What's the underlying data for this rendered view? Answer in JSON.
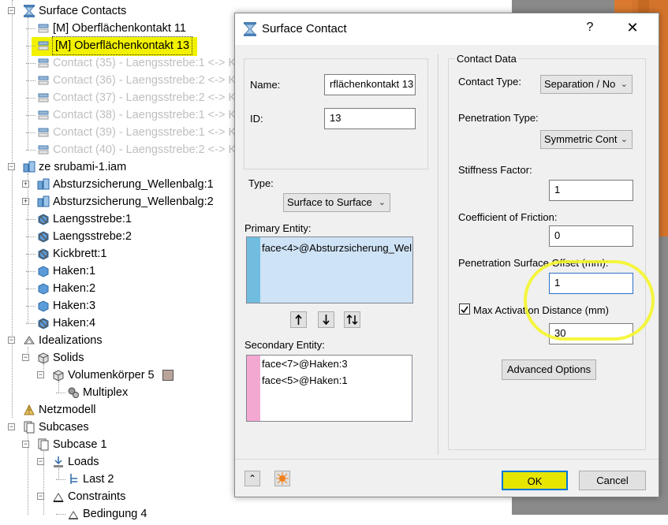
{
  "tree": {
    "rows": [
      {
        "label": "Surface Contacts",
        "icon": "hourglass-icon",
        "dim": false
      },
      {
        "label": "[M] Oberflächenkontakt 11",
        "icon": "contact-icon",
        "dim": false
      },
      {
        "label": "[M] Oberflächenkontakt 13",
        "icon": "contact-icon",
        "dim": false,
        "selected": true
      },
      {
        "label": "Contact (35) - Laengsstrebe:1 <-> K",
        "icon": "contact-icon",
        "dim": true
      },
      {
        "label": "Contact (36) - Laengsstrebe:2 <-> K",
        "icon": "contact-icon",
        "dim": true
      },
      {
        "label": "Contact (37) - Laengsstrebe:2 <-> K",
        "icon": "contact-icon",
        "dim": true
      },
      {
        "label": "Contact (38) - Laengsstrebe:1 <-> K",
        "icon": "contact-icon",
        "dim": true
      },
      {
        "label": "Contact (39) - Laengsstrebe:1 <-> K",
        "icon": "contact-icon",
        "dim": true
      },
      {
        "label": "Contact (40) - Laengsstrebe:2 <-> K",
        "icon": "contact-icon",
        "dim": true
      },
      {
        "label": "ze srubami-1.iam",
        "icon": "assembly-icon",
        "dim": false
      },
      {
        "label": "Absturzsicherung_Wellenbalg:1",
        "icon": "assembly-icon",
        "dim": false
      },
      {
        "label": "Absturzsicherung_Wellenbalg:2",
        "icon": "assembly-icon",
        "dim": false
      },
      {
        "label": "Laengsstrebe:1",
        "icon": "part-disabled-icon",
        "dim": false
      },
      {
        "label": "Laengsstrebe:2",
        "icon": "part-disabled-icon",
        "dim": false
      },
      {
        "label": "Kickbrett:1",
        "icon": "part-disabled-icon",
        "dim": false
      },
      {
        "label": "Haken:1",
        "icon": "part-icon",
        "dim": false
      },
      {
        "label": "Haken:2",
        "icon": "part-icon",
        "dim": false
      },
      {
        "label": "Haken:3",
        "icon": "part-icon",
        "dim": false
      },
      {
        "label": "Haken:4",
        "icon": "part-disabled-icon",
        "dim": false
      },
      {
        "label": "Idealizations",
        "icon": "idealizations-icon",
        "dim": false
      },
      {
        "label": "Solids",
        "icon": "solids-icon",
        "dim": false
      },
      {
        "label": "Volumenkörper 5",
        "icon": "solids-icon",
        "dim": false
      },
      {
        "label": "Multiplex",
        "icon": "material-icon",
        "dim": false
      },
      {
        "label": "Netzmodell",
        "icon": "mesh-icon",
        "dim": false
      },
      {
        "label": "Subcases",
        "icon": "subcases-icon",
        "dim": false
      },
      {
        "label": "Subcase 1",
        "icon": "subcases-icon",
        "dim": false
      },
      {
        "label": "Loads",
        "icon": "loads-icon",
        "dim": false
      },
      {
        "label": "Last 2",
        "icon": "load-item-icon",
        "dim": false
      },
      {
        "label": "Constraints",
        "icon": "constraints-icon",
        "dim": false
      },
      {
        "label": "Bedingung 4",
        "icon": "constraint-item-icon",
        "dim": false
      }
    ]
  },
  "dialog": {
    "title": "Surface Contact",
    "help_label": "?",
    "close_label": "✕",
    "name_label": "Name:",
    "name_value": "rflächenkontakt 13",
    "id_label": "ID:",
    "id_value": "13",
    "type_label": "Type:",
    "type_value": "Surface to Surface",
    "primary_label": "Primary Entity:",
    "primary_items": [
      "face<4>@Absturzsicherung_Wel"
    ],
    "secondary_label": "Secondary Entity:",
    "secondary_items": [
      "face<7>@Haken:3",
      "face<5>@Haken:1"
    ],
    "contact_data": {
      "group_label": "Contact Data",
      "contact_type_label": "Contact Type:",
      "contact_type_value": "Separation / No",
      "penetration_type_label": "Penetration Type:",
      "penetration_type_value": "Symmetric Cont",
      "stiffness_label": "Stiffness Factor:",
      "stiffness_value": "1",
      "friction_label": "Coefficient of Friction:",
      "friction_value": "0",
      "offset_label": "Penetration Surface Offset (mm):",
      "offset_value": "1",
      "max_activation_label": "Max Activation Distance (mm)",
      "max_activation_checked": true,
      "max_activation_value": "30",
      "advanced_label": "Advanced Options"
    },
    "ok_label": "OK",
    "cancel_label": "Cancel"
  },
  "colors": {
    "highlight_yellow": "#f2f200",
    "primary_list_bg": "#cfe3f6",
    "primary_bar": "#71bde0",
    "secondary_bar": "#f3a8d2",
    "viewport_gray": "#8a8a8a",
    "viewport_orange": "#d4742c"
  }
}
